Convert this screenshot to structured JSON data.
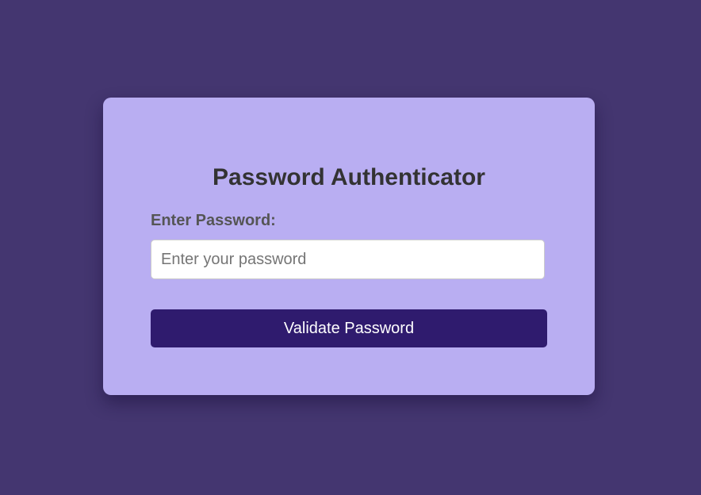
{
  "card": {
    "title": "Password Authenticator",
    "password_label": "Enter Password:",
    "password_input": {
      "value": "",
      "placeholder": "Enter your password"
    },
    "validate_button_label": "Validate Password"
  },
  "colors": {
    "page_background": "#443670",
    "card_background": "#b9aef2",
    "button_background": "#2f1b6e",
    "title_text": "#333333",
    "label_text": "#555555"
  }
}
